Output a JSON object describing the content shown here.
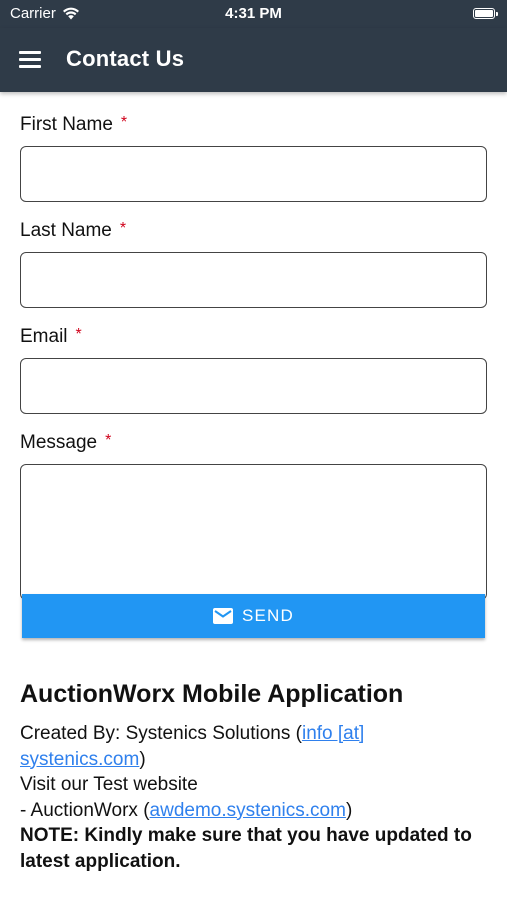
{
  "status_bar": {
    "carrier": "Carrier",
    "time": "4:31 PM"
  },
  "header": {
    "title": "Contact Us"
  },
  "form": {
    "required_mark": "*",
    "first_name_label": "First Name",
    "first_name_value": "",
    "last_name_label": "Last Name",
    "last_name_value": "",
    "email_label": "Email",
    "email_value": "",
    "message_label": "Message",
    "message_value": "",
    "send_label": "SEND"
  },
  "info": {
    "title": "AuctionWorx Mobile Application",
    "created_by_prefix": "Created By: Systenics Solutions (",
    "email_link_line1": "info [at]",
    "email_link_line2": "systenics.com",
    "created_by_suffix": ")",
    "visit_text": "Visit our Test website",
    "site_prefix": "- AuctionWorx (",
    "site_link": "awdemo.systenics.com",
    "site_suffix": ")",
    "note": "NOTE: Kindly make sure that you have updated to latest application."
  },
  "colors": {
    "header_bg": "#2f3b48",
    "button_bg": "#2196f3",
    "required": "#d0021b",
    "link": "#2f80ed"
  },
  "icons": {
    "menu": "hamburger-menu-icon",
    "wifi": "wifi-icon",
    "battery": "battery-icon",
    "send": "mail-icon"
  }
}
